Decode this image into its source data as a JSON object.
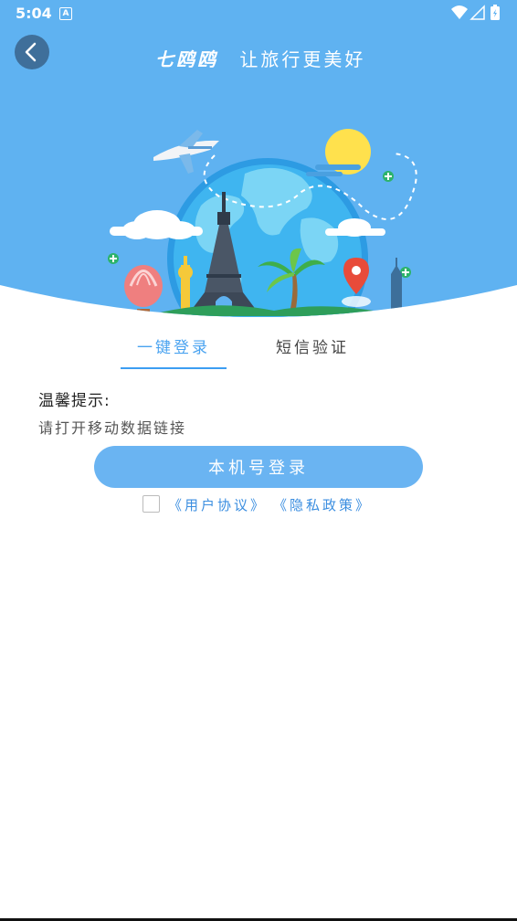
{
  "status_bar": {
    "time": "5:04",
    "notification_icon": "A"
  },
  "header": {
    "brand_name": "七鸥鸥",
    "slogan": "让旅行更美好"
  },
  "tabs": [
    {
      "label": "一键登录",
      "active": true
    },
    {
      "label": "短信验证",
      "active": false
    }
  ],
  "tip": {
    "title": "温馨提示:",
    "text": "请打开移动数据链接"
  },
  "login_button": {
    "label": "本机号登录"
  },
  "agreement": {
    "user_agreement": "《用户协议》",
    "privacy_policy": "《隐私政策》",
    "checked": false
  },
  "colors": {
    "hero_blue": "#5fb2f1",
    "accent": "#3c9ef2",
    "button": "#6ab4f2",
    "link": "#3b8ee0"
  },
  "icons": [
    "back-arrow-icon",
    "wifi-icon",
    "signal-icon",
    "battery-icon",
    "notification-icon"
  ]
}
